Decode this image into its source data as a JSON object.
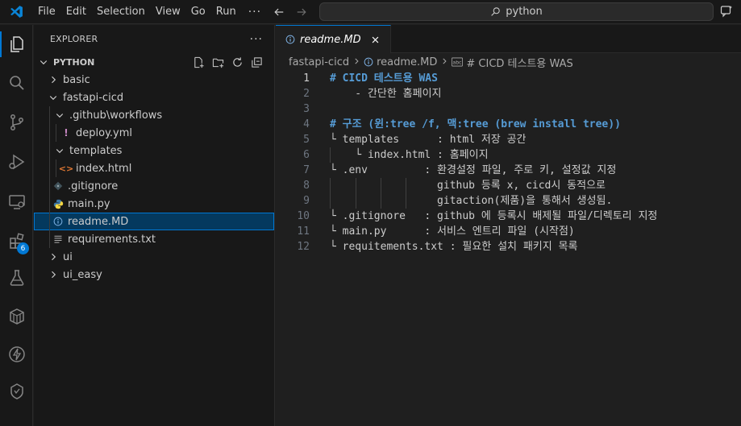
{
  "menu": [
    "File",
    "Edit",
    "Selection",
    "View",
    "Go",
    "Run"
  ],
  "menu_more": "···",
  "search": {
    "text": "python"
  },
  "activity": {
    "extensions_badge": "6"
  },
  "sidebar": {
    "title": "EXPLORER",
    "more": "···",
    "section": "PYTHON",
    "items": [
      {
        "label": "basic",
        "type": "folder",
        "open": false,
        "depth": 1
      },
      {
        "label": "fastapi-cicd",
        "type": "folder",
        "open": true,
        "depth": 1
      },
      {
        "label": ".github\\workflows",
        "type": "folder",
        "open": true,
        "depth": 2
      },
      {
        "label": "deploy.yml",
        "type": "yml",
        "depth": 3
      },
      {
        "label": "templates",
        "type": "folder",
        "open": true,
        "depth": 2
      },
      {
        "label": "index.html",
        "type": "html",
        "depth": 3
      },
      {
        "label": ".gitignore",
        "type": "git",
        "depth": 2
      },
      {
        "label": "main.py",
        "type": "py",
        "depth": 2
      },
      {
        "label": "readme.MD",
        "type": "md",
        "depth": 2,
        "selected": true
      },
      {
        "label": "requirements.txt",
        "type": "txt",
        "depth": 2
      },
      {
        "label": "ui",
        "type": "folder",
        "open": false,
        "depth": 1
      },
      {
        "label": "ui_easy",
        "type": "folder",
        "open": false,
        "depth": 1
      }
    ]
  },
  "editor": {
    "tab": "readme.MD",
    "breadcrumbs": [
      "fastapi-cicd",
      "readme.MD",
      "# CICD 테스트용 WAS"
    ],
    "current_line": 1,
    "lines": [
      {
        "n": "1",
        "text": "# CICD 테스트용 WAS",
        "heading": true
      },
      {
        "n": "2",
        "text": "    - 간단한 홈페이지"
      },
      {
        "n": "3",
        "text": ""
      },
      {
        "n": "4",
        "text": "# 구조 (윈:tree /f, 맥:tree (brew install tree))",
        "heading": true
      },
      {
        "n": "5",
        "text": "└ templates      : html 저장 공간"
      },
      {
        "n": "6",
        "text": "    └ index.html : 홈페이지"
      },
      {
        "n": "7",
        "text": "└ .env         : 환경설정 파일, 주로 키, 설정값 지정"
      },
      {
        "n": "8",
        "text": "                 github 등록 x, cicd시 동적으로"
      },
      {
        "n": "9",
        "text": "                 gitaction(제품)을 통해서 생성됨."
      },
      {
        "n": "10",
        "text": "└ .gitignore   : github 에 등록시 배제될 파일/디렉토리 지정"
      },
      {
        "n": "11",
        "text": "└ main.py      : 서비스 엔트리 파일 (시작점)"
      },
      {
        "n": "12",
        "text": "└ requitements.txt : 필요한 설치 패키지 목록"
      }
    ]
  }
}
